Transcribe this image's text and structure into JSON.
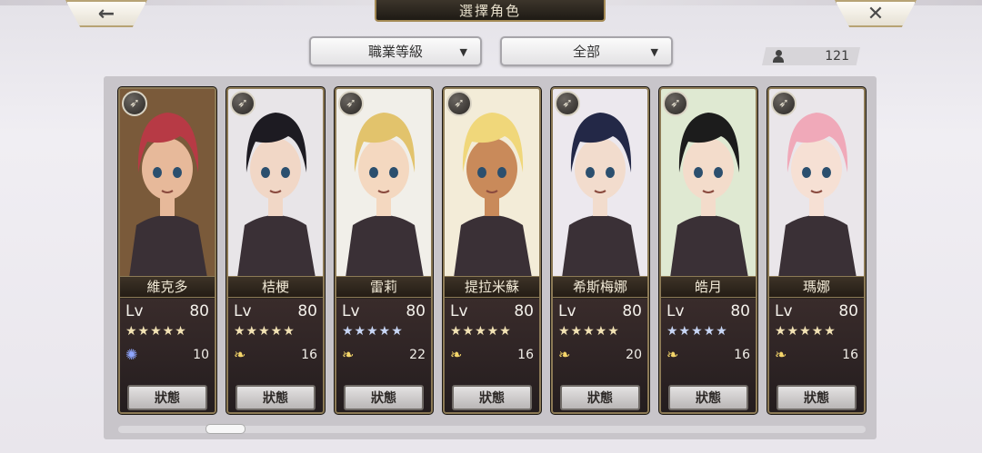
{
  "header": {
    "title": "選擇角色",
    "back_icon": "←",
    "close_icon": "✕"
  },
  "filters": {
    "class_level": "職業等級",
    "category": "全部",
    "dropdown_arrow": "▼"
  },
  "roster_count": "121",
  "status_label": "狀態",
  "characters": [
    {
      "name": "維克多",
      "lv_label": "Lv",
      "level": "80",
      "stars": "★★★★★",
      "star_color": "gold",
      "item_icon": "swirl-icon",
      "item_count": "10",
      "hair": "#b73a45",
      "skin": "#e7b99a",
      "bg": "#7a5a3a"
    },
    {
      "name": "桔梗",
      "lv_label": "Lv",
      "level": "80",
      "stars": "★★★★★",
      "star_color": "gold",
      "item_icon": "wing-icon",
      "item_count": "16",
      "hair": "#1d1b22",
      "skin": "#f1d7c6",
      "bg": "#e8e5e8"
    },
    {
      "name": "雷莉",
      "lv_label": "Lv",
      "level": "80",
      "stars": "★★★★★",
      "star_color": "blue",
      "item_icon": "wing-icon",
      "item_count": "22",
      "hair": "#e2c36c",
      "skin": "#f4d8c0",
      "bg": "#f1efe9"
    },
    {
      "name": "提拉米蘇",
      "lv_label": "Lv",
      "level": "80",
      "stars": "★★★★★",
      "star_color": "gold",
      "item_icon": "wing-icon",
      "item_count": "16",
      "hair": "#f0d77a",
      "skin": "#c98a5a",
      "bg": "#f3ecd8"
    },
    {
      "name": "希斯梅娜",
      "lv_label": "Lv",
      "level": "80",
      "stars": "★★★★★",
      "star_color": "gold",
      "item_icon": "wing-icon",
      "item_count": "20",
      "hair": "#232847",
      "skin": "#f2dccd",
      "bg": "#ece8ee"
    },
    {
      "name": "皓月",
      "lv_label": "Lv",
      "level": "80",
      "stars": "★★★★★",
      "star_color": "blue",
      "item_icon": "wing-icon",
      "item_count": "16",
      "hair": "#1c1c1c",
      "skin": "#f3dccb",
      "bg": "#dfe9d2"
    },
    {
      "name": "瑪娜",
      "lv_label": "Lv",
      "level": "80",
      "stars": "★★★★★",
      "star_color": "gold",
      "item_icon": "wing-icon",
      "item_count": "16",
      "hair": "#f0a9b9",
      "skin": "#f6e0d4",
      "bg": "#eae6ea"
    }
  ]
}
